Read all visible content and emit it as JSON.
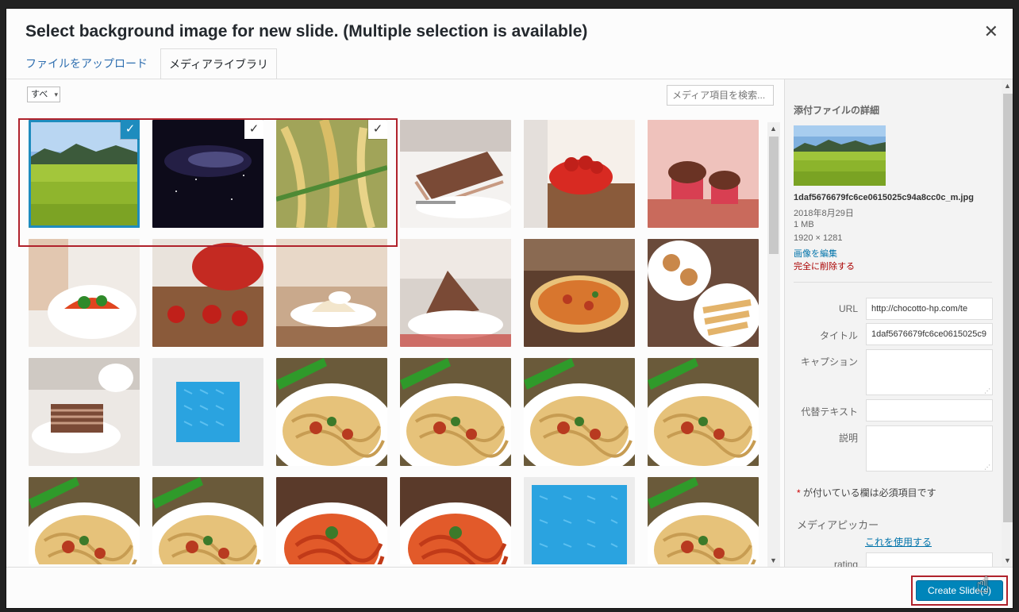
{
  "modal": {
    "title": "Select background image for new slide. (Multiple selection is available)",
    "close_icon": "close-icon"
  },
  "tabs": [
    {
      "label": "ファイルをアップロード",
      "active": false
    },
    {
      "label": "メディアライブラリ",
      "active": true
    }
  ],
  "toolbar": {
    "filter_value": "すべ",
    "search_placeholder": "メディア項目を検索..."
  },
  "thumbnails": [
    {
      "kind": "field",
      "selected": true,
      "focused": true
    },
    {
      "kind": "night",
      "selected": true,
      "focused": false
    },
    {
      "kind": "rice",
      "selected": true,
      "focused": false
    },
    {
      "kind": "cake",
      "selected": false
    },
    {
      "kind": "strawberry-bowl",
      "selected": false
    },
    {
      "kind": "muffin",
      "selected": false
    },
    {
      "kind": "salad",
      "selected": false
    },
    {
      "kind": "strawberries",
      "selected": false
    },
    {
      "kind": "cafe-dessert",
      "selected": false
    },
    {
      "kind": "cake-plate",
      "selected": false
    },
    {
      "kind": "pizza",
      "selected": false
    },
    {
      "kind": "pastries",
      "selected": false
    },
    {
      "kind": "layer-cake",
      "selected": false
    },
    {
      "kind": "blue-pattern",
      "selected": false
    },
    {
      "kind": "pasta-ribbon",
      "selected": false
    },
    {
      "kind": "pasta-ribbon",
      "selected": false
    },
    {
      "kind": "pasta-ribbon",
      "selected": false
    },
    {
      "kind": "pasta-ribbon",
      "selected": false
    },
    {
      "kind": "pasta-ribbon",
      "selected": false
    },
    {
      "kind": "pasta-ribbon",
      "selected": false
    },
    {
      "kind": "tomato-pasta",
      "selected": false
    },
    {
      "kind": "tomato-pasta",
      "selected": false
    },
    {
      "kind": "blue-pattern-large",
      "selected": false
    },
    {
      "kind": "pasta-ribbon",
      "selected": false
    }
  ],
  "sidebar": {
    "heading": "添付ファイルの詳細",
    "filename": "1daf5676679fc6ce0615025c94a8cc0c_m.jpg",
    "date": "2018年8月29日",
    "size": "1 MB",
    "dimensions": "1920 × 1281",
    "edit_link": "画像を編集",
    "delete_link": "完全に削除する",
    "fields": {
      "url_label": "URL",
      "url_value": "http://chocotto-hp.com/te",
      "title_label": "タイトル",
      "title_value": "1daf5676679fc6ce0615025c9",
      "caption_label": "キャプション",
      "alt_label": "代替テキスト",
      "desc_label": "説明"
    },
    "required_note_asterisk": "*",
    "required_note": " が付いている欄は必須項目です",
    "media_picker_label": "メディアピッカー",
    "media_picker_link": "これを使用する",
    "rating_label": "rating"
  },
  "footer": {
    "create_button": "Create Slide(s)"
  },
  "colors": {
    "accent": "#0085ba",
    "selection_blue": "#1e8cbe",
    "highlight_red": "#b0222c",
    "delete_red": "#a00",
    "link_blue": "#0073aa"
  }
}
